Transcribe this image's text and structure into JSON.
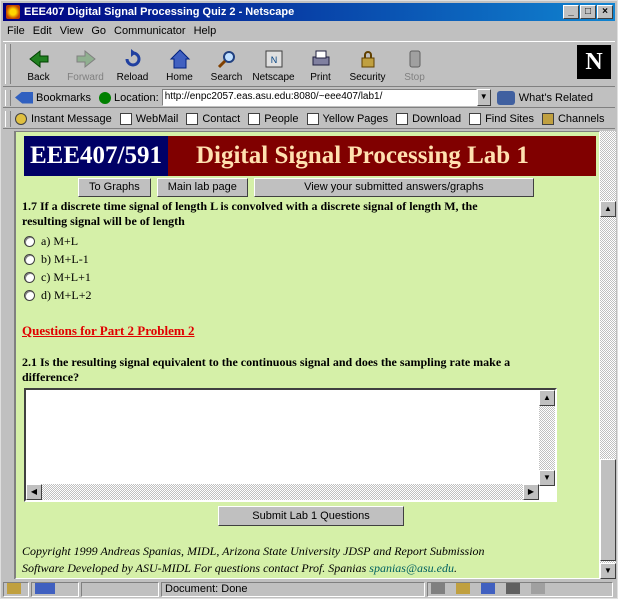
{
  "window": {
    "title": "EEE407 Digital Signal Processing Quiz 2 - Netscape",
    "min": "_",
    "max": "□",
    "close": "×"
  },
  "menu": [
    "File",
    "Edit",
    "View",
    "Go",
    "Communicator",
    "Help"
  ],
  "toolbar": {
    "buttons": [
      {
        "label": "Back",
        "icon": "back-arrow-icon"
      },
      {
        "label": "Forward",
        "icon": "forward-arrow-icon"
      },
      {
        "label": "Reload",
        "icon": "reload-icon"
      },
      {
        "label": "Home",
        "icon": "home-icon"
      },
      {
        "label": "Search",
        "icon": "search-icon"
      },
      {
        "label": "Netscape",
        "icon": "netscape-icon"
      },
      {
        "label": "Print",
        "icon": "print-icon"
      },
      {
        "label": "Security",
        "icon": "security-lock-icon"
      },
      {
        "label": "Stop",
        "icon": "stop-icon"
      }
    ],
    "logo": "N"
  },
  "location": {
    "bookmarks_label": "Bookmarks",
    "location_label": "Location:",
    "url": "http://enpc2057.eas.asu.edu:8080/~eee407/lab1/",
    "related_label": "What's Related"
  },
  "personal": [
    "Instant Message",
    "WebMail",
    "Contact",
    "People",
    "Yellow Pages",
    "Download",
    "Find Sites",
    "Channels"
  ],
  "page": {
    "course": "EEE407/591",
    "title": "Digital Signal Processing Lab 1",
    "nav": [
      "To Graphs",
      "Main lab page",
      "View your submitted answers/graphs"
    ],
    "q17_line1": "1.7 If a discrete time signal of length L is convolved with a discrete signal of length M, the",
    "q17_line2": "resulting signal will be of length",
    "options": [
      "a) M+L",
      "b) M+L-1",
      "c) M+L+1",
      "d) M+L+2"
    ],
    "part_link": "Questions for Part 2 Problem 2",
    "q21_line1": "2.1 Is the resulting signal equivalent to the continuous signal and does the sampling rate make a",
    "q21_line2": "difference?",
    "submit": "Submit Lab 1 Questions",
    "copyright_line1": "Copyright 1999 Andreas Spanias, MIDL, Arizona State University JDSP and Report Submission",
    "copyright_line2": "Software Developed by ASU-MIDL For questions contact Prof. Spanias",
    "email": "spanias@asu.edu",
    "period": "."
  },
  "status": {
    "text": "Document: Done"
  }
}
